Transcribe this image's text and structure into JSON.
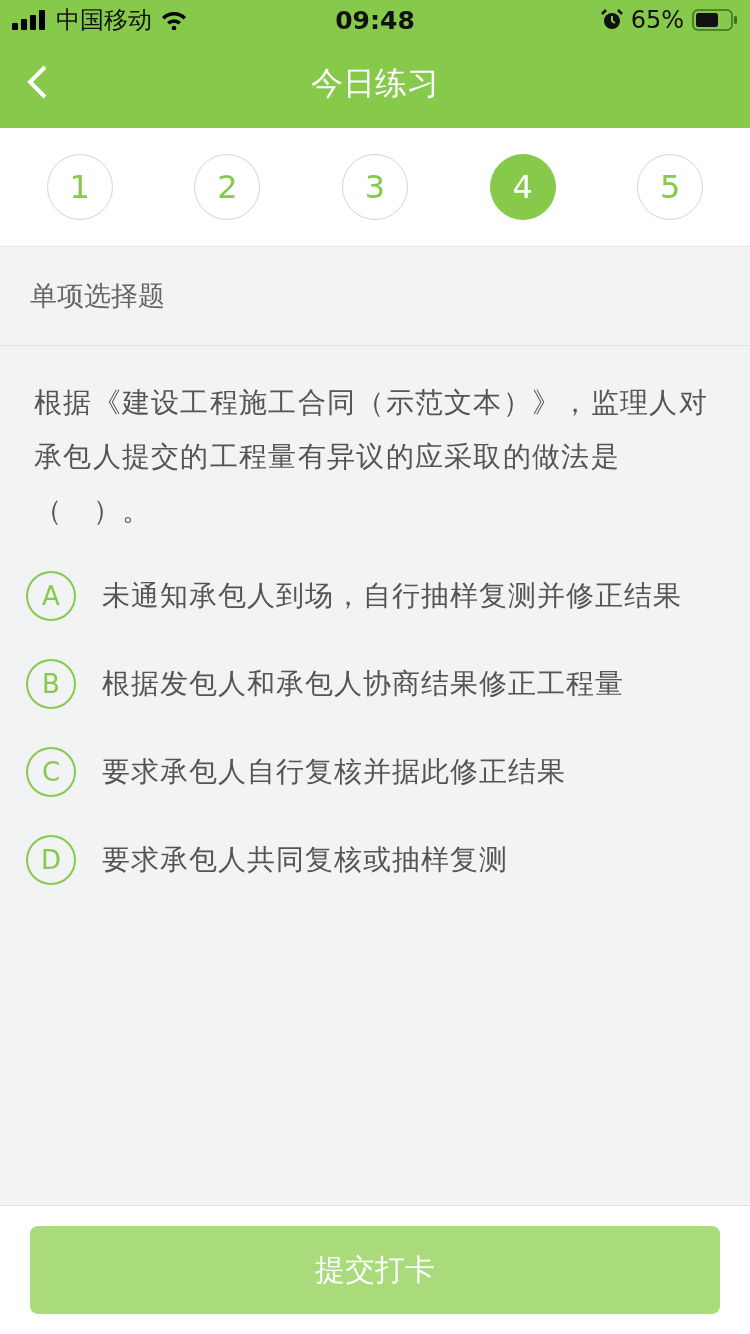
{
  "status_bar": {
    "carrier": "中国移动",
    "time": "09:48",
    "battery": "65%"
  },
  "nav": {
    "title": "今日练习"
  },
  "steps": [
    {
      "label": "1",
      "selected": false
    },
    {
      "label": "2",
      "selected": false
    },
    {
      "label": "3",
      "selected": false
    },
    {
      "label": "4",
      "selected": true
    },
    {
      "label": "5",
      "selected": false
    }
  ],
  "question_type": "单项选择题",
  "question_lines": [
    "根据《建设工程施工合同（示范文本）》，监理人对承包人提交的工程量有异议的应采取的做法是",
    "（　）。"
  ],
  "options": [
    {
      "letter": "A",
      "text": "未通知承包人到场，自行抽样复测并修正结果",
      "selected": false
    },
    {
      "letter": "B",
      "text": "根据发包人和承包人协商结果修正工程量",
      "selected": false
    },
    {
      "letter": "C",
      "text": "要求承包人自行复核并据此修正结果",
      "selected": false
    },
    {
      "letter": "D",
      "text": "要求承包人共同复核或抽样复测",
      "selected": false
    }
  ],
  "submit": {
    "label": "提交打卡",
    "disabled": true
  }
}
